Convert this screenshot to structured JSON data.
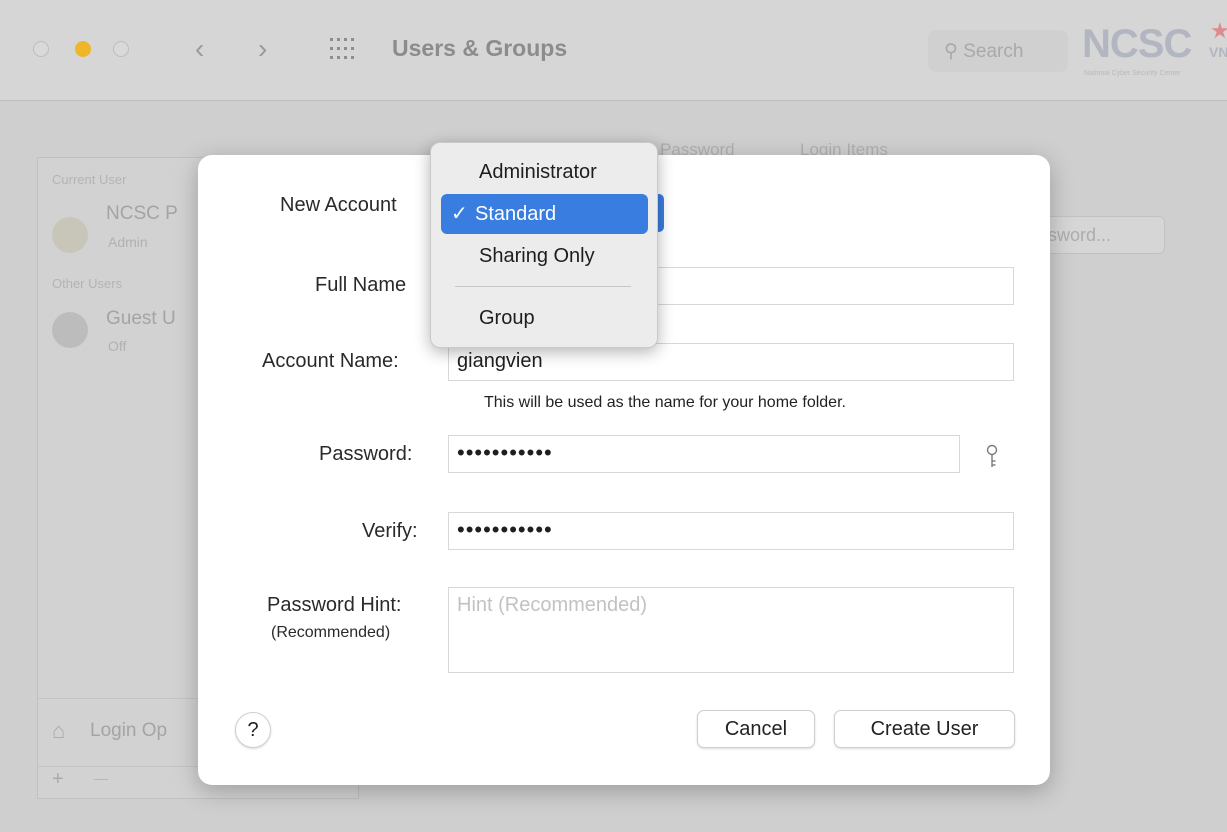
{
  "window": {
    "title": "Users & Groups",
    "search_placeholder": "Search",
    "logo": {
      "main": "NCSC",
      "suffix": "VN",
      "tagline": "National Cyber Security Center"
    }
  },
  "background": {
    "sidebar": {
      "current_user_section": "Current User",
      "current_user_name": "NCSC P",
      "current_user_role": "Admin",
      "other_users_section": "Other Users",
      "guest_name": "Guest U",
      "guest_status": "Off",
      "login_options": "Login Op",
      "add_label": "+",
      "remove_label": "—"
    },
    "tabs": [
      "Password",
      "Login Items"
    ],
    "change_password_button": "sword..."
  },
  "dialog": {
    "new_account_label": "New Account",
    "full_name_label": "Full Name",
    "account_name_label": "Account Name:",
    "account_name_value": "giangvien",
    "home_folder_hint": "This will be used as the name for your home folder.",
    "password_label": "Password:",
    "password_value": "•••••••••••",
    "verify_label": "Verify:",
    "verify_value": "•••••••••••",
    "password_hint_label": "Password Hint:",
    "password_hint_sublabel": "(Recommended)",
    "password_hint_placeholder": "Hint (Recommended)",
    "help_label": "?",
    "cancel_label": "Cancel",
    "create_label": "Create User"
  },
  "account_type_menu": {
    "items": [
      "Administrator",
      "Standard",
      "Sharing Only",
      "Group"
    ],
    "selected": "Standard",
    "check_mark": "✓",
    "accent_color": "#3a7de0"
  }
}
